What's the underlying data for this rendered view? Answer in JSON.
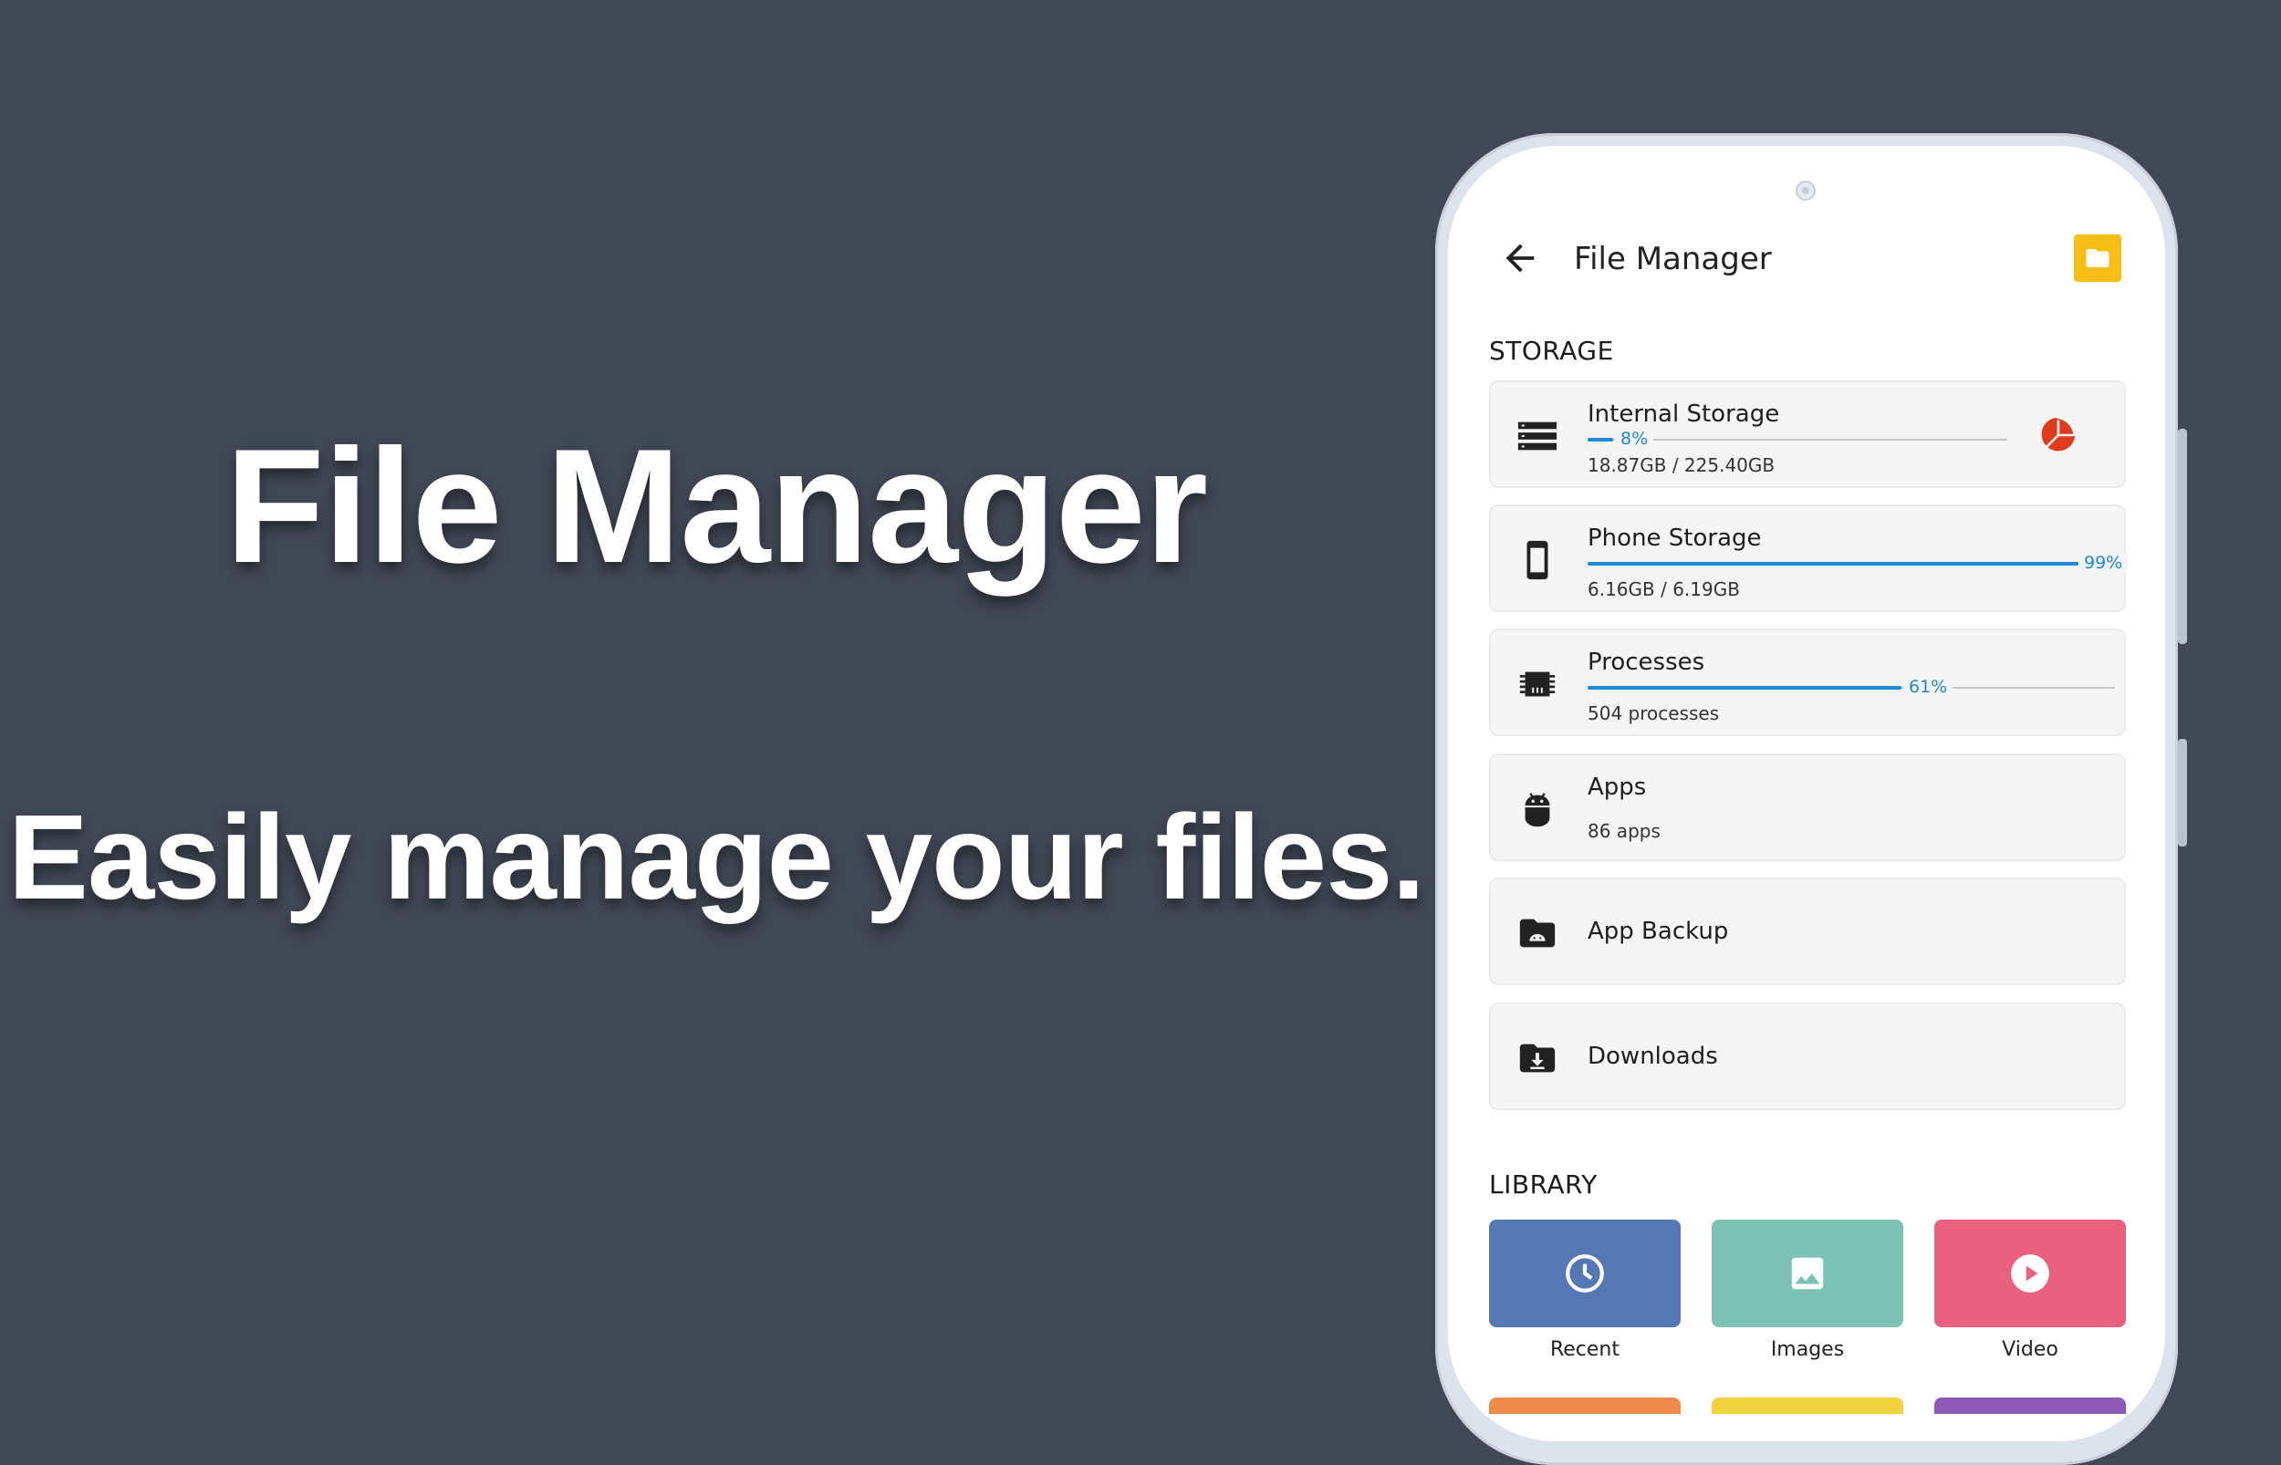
{
  "promo": {
    "title": "File Manager",
    "subtitle": "Easily manage your files."
  },
  "appbar": {
    "title": "File Manager",
    "back_icon": "arrow-back-icon",
    "action_icon": "folder-icon",
    "accent_color": "#f7be16"
  },
  "storage": {
    "section_title": "STORAGE",
    "items": [
      {
        "title": "Internal Storage",
        "percent_label": "8%",
        "percent": 8,
        "detail": "18.87GB / 225.40GB",
        "icon": "storage-icon",
        "extra_icon": "pie-chart-icon"
      },
      {
        "title": "Phone Storage",
        "percent_label": "99%",
        "percent": 99,
        "detail": "6.16GB / 6.19GB",
        "icon": "phone-icon"
      },
      {
        "title": "Processes",
        "percent_label": "61%",
        "percent": 61,
        "detail": "504 processes",
        "icon": "chip-icon"
      },
      {
        "title": "Apps",
        "detail": "86 apps",
        "icon": "android-icon"
      },
      {
        "title": "App Backup",
        "icon": "android-folder-icon"
      },
      {
        "title": "Downloads",
        "icon": "download-folder-icon"
      }
    ],
    "progress_color": "#1e88d2"
  },
  "library": {
    "section_title": "LIBRARY",
    "tiles": [
      {
        "label": "Recent",
        "icon": "clock-icon",
        "color": "#5577b4"
      },
      {
        "label": "Images",
        "icon": "image-icon",
        "color": "#7bc1b4"
      },
      {
        "label": "Video",
        "icon": "play-icon",
        "color": "#e9617f"
      }
    ],
    "partial_tile_colors": [
      "#ef8a4a",
      "#f1d23f",
      "#8e58b6"
    ]
  }
}
